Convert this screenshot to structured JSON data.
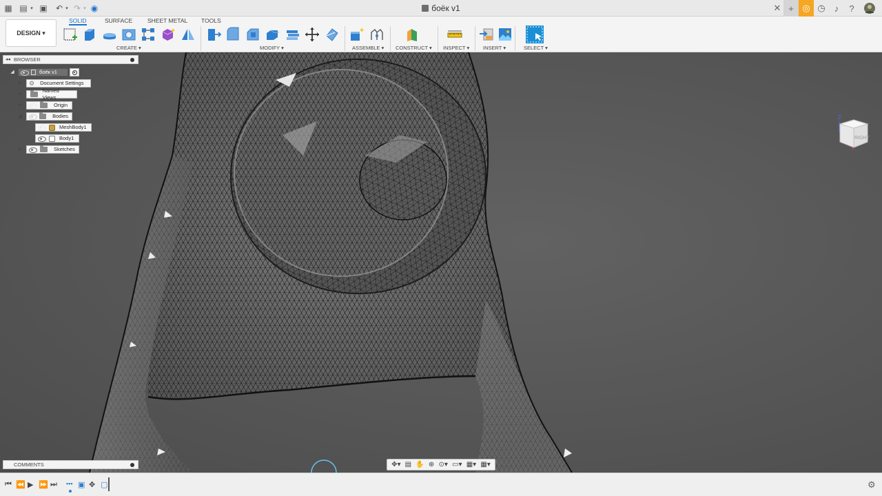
{
  "app": {
    "document_title": "боёк v1"
  },
  "ribbon": {
    "workspace_label": "DESIGN",
    "tabs": [
      {
        "label": "SOLID",
        "active": true
      },
      {
        "label": "SURFACE",
        "active": false
      },
      {
        "label": "SHEET METAL",
        "active": false
      },
      {
        "label": "TOOLS",
        "active": false
      }
    ],
    "groups": {
      "create": "CREATE",
      "modify": "MODIFY",
      "assemble": "ASSEMBLE",
      "construct": "CONSTRUCT",
      "inspect": "INSPECT",
      "insert": "INSERT",
      "select": "SELECT"
    }
  },
  "browser": {
    "header": "BROWSER",
    "root": "боёк v1",
    "items": [
      {
        "label": "Document Settings"
      },
      {
        "label": "Named Views"
      },
      {
        "label": "Origin"
      },
      {
        "label": "Bodies"
      },
      {
        "label": "MeshBody1"
      },
      {
        "label": "Body1"
      },
      {
        "label": "Sketches"
      }
    ]
  },
  "comments": {
    "label": "COMMENTS"
  },
  "viewcube": {
    "face_label": "RIGHT",
    "axis_z": "Z"
  },
  "colors": {
    "accent": "#1a73c9",
    "mesh_fill": "#6f6f6f",
    "mesh_line": "#141414",
    "viewport_bg": "#575757"
  }
}
